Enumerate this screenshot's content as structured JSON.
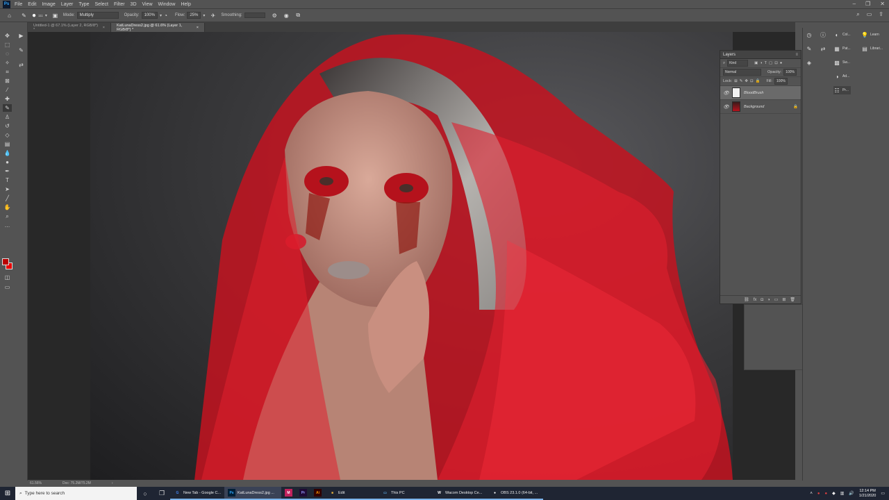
{
  "menu": {
    "app_logo": "Ps",
    "items": [
      "File",
      "Edit",
      "Image",
      "Layer",
      "Type",
      "Select",
      "Filter",
      "3D",
      "View",
      "Window",
      "Help"
    ]
  },
  "options": {
    "mode_label": "Mode:",
    "mode_value": "Multiply",
    "opacity_label": "Opacity:",
    "opacity_value": "100%",
    "flow_label": "Flow:",
    "flow_value": "25%",
    "smoothing_label": "Smoothing:",
    "brush_size": "111"
  },
  "tabs": [
    {
      "label": "Untitled-1 @ 67.1% (Layer 2, RGB/8*) *"
    },
    {
      "label": "KatLunaDress2.jpg @ 61.6% (Layer 1, RGB/8*) *"
    }
  ],
  "status": {
    "zoom": "61.56%",
    "doc": "Doc: 75.2M/75.2M"
  },
  "layers_panel": {
    "title": "Layers",
    "kind_label": "Kind",
    "blend_mode": "Normal",
    "opacity_label": "Opacity:",
    "opacity_value": "100%",
    "lock_label": "Lock:",
    "fill_label": "Fill:",
    "fill_value": "100%",
    "layers": [
      {
        "name": "BloodBrush",
        "selected": true
      },
      {
        "name": "Background",
        "selected": false
      }
    ]
  },
  "right_dock": {
    "col1": [
      "Col...",
      "Pat...",
      "Sw...",
      "Ad...",
      "Pr..."
    ],
    "col2": [
      "Learn",
      "Librari..."
    ]
  },
  "taskbar": {
    "search_placeholder": "Type here to search",
    "apps": [
      {
        "label": "New Tab - Google C...",
        "badge": "G",
        "color": "#4285f4"
      },
      {
        "label": "KatLunaDress2.jpg ...",
        "badge": "Ps",
        "color": "#31a8ff"
      },
      {
        "label": "",
        "badge": "M",
        "color": "#c1225c"
      },
      {
        "label": "",
        "badge": "Pr",
        "color": "#9999ff"
      },
      {
        "label": "",
        "badge": "Ai",
        "color": "#ff9a00"
      },
      {
        "label": "Edit",
        "badge": "■",
        "color": "#e8b13c"
      },
      {
        "label": "This PC",
        "badge": "▭",
        "color": "#5aa7e0"
      },
      {
        "label": "Wacom Desktop Ce...",
        "badge": "W",
        "color": "#ffffff"
      },
      {
        "label": "OBS 23.1.0 (64-bit, ...",
        "badge": "●",
        "color": "#ffffff"
      }
    ],
    "time": "12:14 PM",
    "date": "1/21/2020"
  }
}
